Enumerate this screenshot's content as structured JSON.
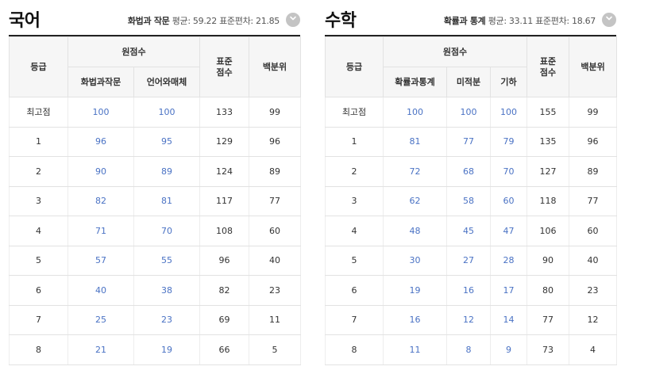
{
  "korean": {
    "title": "국어",
    "elective": "화법과 작문",
    "stats": "평균: 59.22 표준편차: 21.85",
    "headers": {
      "grade": "등급",
      "raw": "원점수",
      "sub1": "화법과작문",
      "sub2": "언어와매체",
      "std": "표준\n점수",
      "pct": "백분위"
    },
    "rows": [
      {
        "grade": "최고점",
        "a": "100",
        "b": "100",
        "std": "133",
        "pct": "99"
      },
      {
        "grade": "1",
        "a": "96",
        "b": "95",
        "std": "129",
        "pct": "96"
      },
      {
        "grade": "2",
        "a": "90",
        "b": "89",
        "std": "124",
        "pct": "89"
      },
      {
        "grade": "3",
        "a": "82",
        "b": "81",
        "std": "117",
        "pct": "77"
      },
      {
        "grade": "4",
        "a": "71",
        "b": "70",
        "std": "108",
        "pct": "60"
      },
      {
        "grade": "5",
        "a": "57",
        "b": "55",
        "std": "96",
        "pct": "40"
      },
      {
        "grade": "6",
        "a": "40",
        "b": "38",
        "std": "82",
        "pct": "23"
      },
      {
        "grade": "7",
        "a": "25",
        "b": "23",
        "std": "69",
        "pct": "11"
      },
      {
        "grade": "8",
        "a": "21",
        "b": "19",
        "std": "66",
        "pct": "5"
      }
    ]
  },
  "math": {
    "title": "수학",
    "elective": "확률과 통계",
    "stats": "평균: 33.11 표준편차: 18.67",
    "headers": {
      "grade": "등급",
      "raw": "원점수",
      "sub1": "확률과통계",
      "sub2": "미적분",
      "sub3": "기하",
      "std": "표준\n점수",
      "pct": "백분위"
    },
    "rows": [
      {
        "grade": "최고점",
        "a": "100",
        "b": "100",
        "c": "100",
        "std": "155",
        "pct": "99"
      },
      {
        "grade": "1",
        "a": "81",
        "b": "77",
        "c": "79",
        "std": "135",
        "pct": "96"
      },
      {
        "grade": "2",
        "a": "72",
        "b": "68",
        "c": "70",
        "std": "127",
        "pct": "89"
      },
      {
        "grade": "3",
        "a": "62",
        "b": "58",
        "c": "60",
        "std": "118",
        "pct": "77"
      },
      {
        "grade": "4",
        "a": "48",
        "b": "45",
        "c": "47",
        "std": "106",
        "pct": "60"
      },
      {
        "grade": "5",
        "a": "30",
        "b": "27",
        "c": "28",
        "std": "90",
        "pct": "40"
      },
      {
        "grade": "6",
        "a": "19",
        "b": "16",
        "c": "17",
        "std": "80",
        "pct": "23"
      },
      {
        "grade": "7",
        "a": "16",
        "b": "12",
        "c": "14",
        "std": "77",
        "pct": "12"
      },
      {
        "grade": "8",
        "a": "11",
        "b": "8",
        "c": "9",
        "std": "73",
        "pct": "4"
      }
    ]
  },
  "icons": {
    "expand": "chevron-down-icon"
  },
  "colors": {
    "score_link": "#4a72c4",
    "header_bg": "#f6f6f6",
    "icon_bg": "#c4c4c4"
  }
}
